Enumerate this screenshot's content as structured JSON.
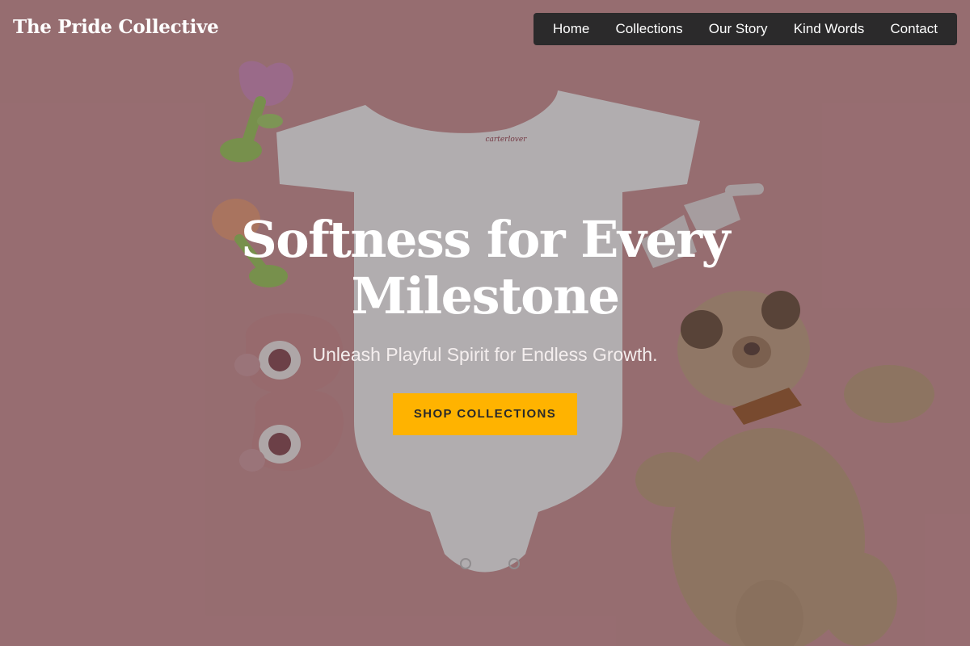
{
  "brand": {
    "name": "The Pride Collective"
  },
  "nav": {
    "items": [
      {
        "label": "Home"
      },
      {
        "label": "Collections"
      },
      {
        "label": "Our Story"
      },
      {
        "label": "Kind Words"
      },
      {
        "label": "Contact"
      }
    ]
  },
  "hero": {
    "title": "Softness for Every Milestone",
    "subtitle": "Unleash Playful Spirit for Endless Growth.",
    "cta_label": "SHOP COLLECTIONS",
    "image_text": "carterlover"
  },
  "colors": {
    "background": "#d39597",
    "nav_background": "#2b2a2b",
    "cta_background": "#ffb300",
    "text": "#ffffff"
  }
}
